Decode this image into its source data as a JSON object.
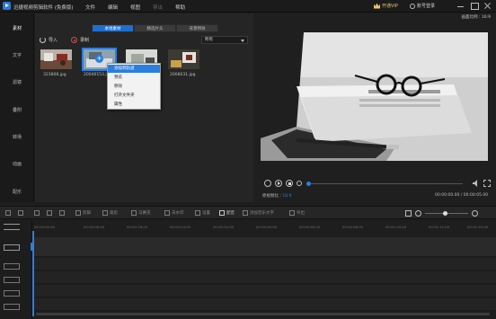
{
  "app": {
    "title": "迅捷视频剪辑软件 (免费版)",
    "menu": [
      "文件",
      "编辑",
      "视图",
      "导出",
      "帮助"
    ],
    "vip_label": "开通VIP",
    "login_label": "账号登录"
  },
  "sidebar": {
    "items": [
      {
        "label": "素材",
        "active": true
      },
      {
        "label": "文字",
        "active": false
      },
      {
        "label": "滤镜",
        "active": false
      },
      {
        "label": "叠附",
        "active": false
      },
      {
        "label": "转场",
        "active": false
      },
      {
        "label": "动画",
        "active": false
      },
      {
        "label": "配乐",
        "active": false
      }
    ]
  },
  "media": {
    "tabs": [
      {
        "label": "本地素材",
        "active": true
      },
      {
        "label": "精选片头",
        "active": false
      },
      {
        "label": "背景特效",
        "active": false
      }
    ],
    "import_label": "导入",
    "record_label": "录制",
    "filter_value": "所有",
    "items": [
      {
        "name": "323808.jpg"
      },
      {
        "name": "20046153.jpg"
      },
      {
        "name": ""
      },
      {
        "name": "2008031.jpg"
      }
    ],
    "plus_glyph": "+"
  },
  "context_menu": {
    "items": [
      "添加到轨道",
      "预览",
      "移除",
      "打开文件夹",
      "属性"
    ],
    "highlighted_index": 0
  },
  "preview": {
    "aspect_label": "画面比例 : 16:9",
    "ratio_text_label": "原视频比 :",
    "ratio_text_value": "16:9",
    "timecode": "00:00:00.00 / 00:00:05.00",
    "progress": 0.0
  },
  "edit_toolbar": {
    "buttons": [
      {
        "label": "剪辑",
        "enabled": false
      },
      {
        "label": "裁剪",
        "enabled": false
      },
      {
        "label": "马赛克",
        "enabled": false
      },
      {
        "label": "去水印",
        "enabled": false
      },
      {
        "label": "设置",
        "enabled": false
      },
      {
        "label": "配音",
        "enabled": true
      },
      {
        "label": "添加音乐文字",
        "enabled": false
      },
      {
        "label": "导出",
        "enabled": false
      }
    ],
    "zoom_level": 0.45
  },
  "timeline": {
    "ticks": [
      "00:00:00.00",
      "00:00:08.00",
      "00:00:16.00",
      "00:00:24.00",
      "00:00:32.00",
      "00:00:40.00",
      "00:00:48.00",
      "00:00:56.00",
      "00:01:04.00",
      "00:01:12.00",
      "00:01:20.00"
    ]
  },
  "colors": {
    "accent": "#2b7fe0",
    "vip": "#e9c26b",
    "background": "#1e1e1e"
  }
}
